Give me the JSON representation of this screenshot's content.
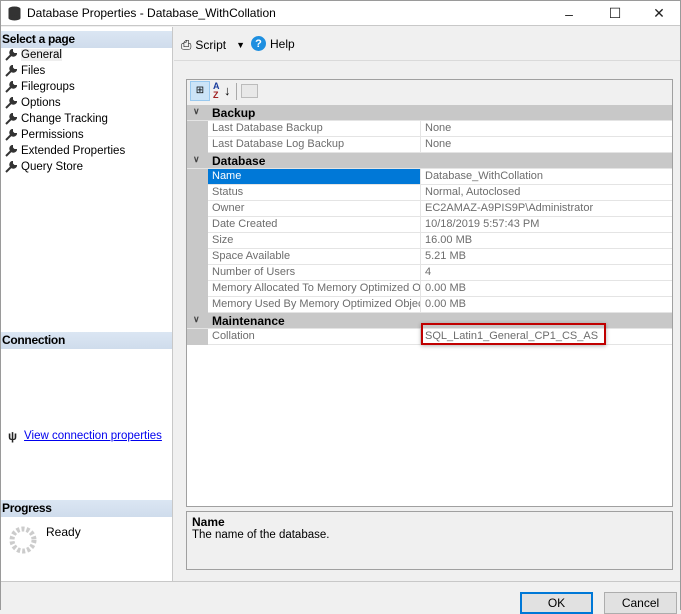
{
  "window": {
    "title": "Database Properties - Database_WithCollation"
  },
  "left": {
    "select_page_header": "Select a page",
    "pages": [
      "General",
      "Files",
      "Filegroups",
      "Options",
      "Change Tracking",
      "Permissions",
      "Extended Properties",
      "Query Store"
    ],
    "connection_header": "Connection",
    "view_connection_link": "View connection properties",
    "progress_header": "Progress",
    "progress_status": "Ready"
  },
  "toolbar": {
    "script_label": "Script",
    "help_label": "Help"
  },
  "grid": {
    "categories": [
      {
        "name": "Backup",
        "rows": [
          [
            "Last Database Backup",
            "None"
          ],
          [
            "Last Database Log Backup",
            "None"
          ]
        ]
      },
      {
        "name": "Database",
        "rows": [
          [
            "Name",
            "Database_WithCollation"
          ],
          [
            "Status",
            "Normal, Autoclosed"
          ],
          [
            "Owner",
            "EC2AMAZ-A9PIS9P\\Administrator"
          ],
          [
            "Date Created",
            "10/18/2019 5:57:43 PM"
          ],
          [
            "Size",
            "16.00 MB"
          ],
          [
            "Space Available",
            "5.21 MB"
          ],
          [
            "Number of Users",
            "4"
          ],
          [
            "Memory Allocated To Memory Optimized Obj",
            "0.00 MB"
          ],
          [
            "Memory Used By Memory Optimized Objects",
            "0.00 MB"
          ]
        ]
      },
      {
        "name": "Maintenance",
        "rows": [
          [
            "Collation",
            "SQL_Latin1_General_CP1_CS_AS"
          ]
        ]
      }
    ],
    "selected": "Name",
    "highlight_color": "#c00000"
  },
  "description": {
    "title": "Name",
    "text": "The name of the database."
  },
  "buttons": {
    "ok": "OK",
    "cancel": "Cancel"
  }
}
